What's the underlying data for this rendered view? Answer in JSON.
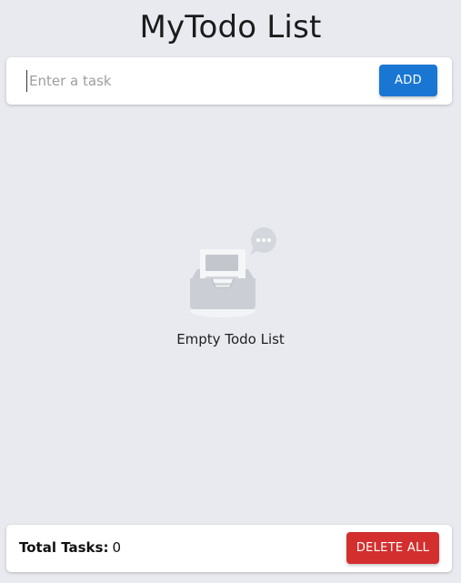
{
  "header": {
    "title": "MyTodo List"
  },
  "input": {
    "value": "",
    "placeholder": "Enter a task",
    "add_label": "ADD"
  },
  "empty_state": {
    "icon": "empty-inbox-icon",
    "text": "Empty Todo List"
  },
  "footer": {
    "total_label": "Total Tasks:",
    "total_count": "0",
    "delete_all_label": "DELETE ALL"
  },
  "colors": {
    "background": "#e8eaef",
    "add_button": "#1976d2",
    "delete_button": "#d32f2f"
  }
}
